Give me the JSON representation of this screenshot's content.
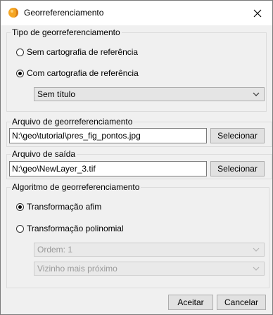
{
  "window": {
    "title": "Georreferenciamento",
    "icon": "app-logo-icon",
    "close_icon": "close-icon"
  },
  "tipo": {
    "legend": "Tipo de georreferenciamento",
    "sem_label": "Sem cartografia de referência",
    "com_label": "Com cartografia de referência",
    "selected": "com",
    "map_select_value": "Sem título"
  },
  "arquivo_geo": {
    "legend": "Arquivo de georreferenciamento",
    "value": "N:\\geo\\tutorial\\pres_fig_pontos.jpg",
    "button": "Selecionar"
  },
  "arquivo_saida": {
    "legend": "Arquivo de saída",
    "value": "N:\\geo\\NewLayer_3.tif",
    "button": "Selecionar"
  },
  "algoritmo": {
    "legend": "Algoritmo de georreferenciamento",
    "afim_label": "Transformação afim",
    "poli_label": "Transformação polinomial",
    "selected": "afim",
    "ordem_value": "Ordem: 1",
    "interp_value": "Vizinho mais próximo"
  },
  "footer": {
    "ok": "Aceitar",
    "cancel": "Cancelar"
  },
  "colors": {
    "accent_icon": "#f5a623",
    "frame": "#dcdcdc",
    "window_bg": "#f0f0f0"
  }
}
